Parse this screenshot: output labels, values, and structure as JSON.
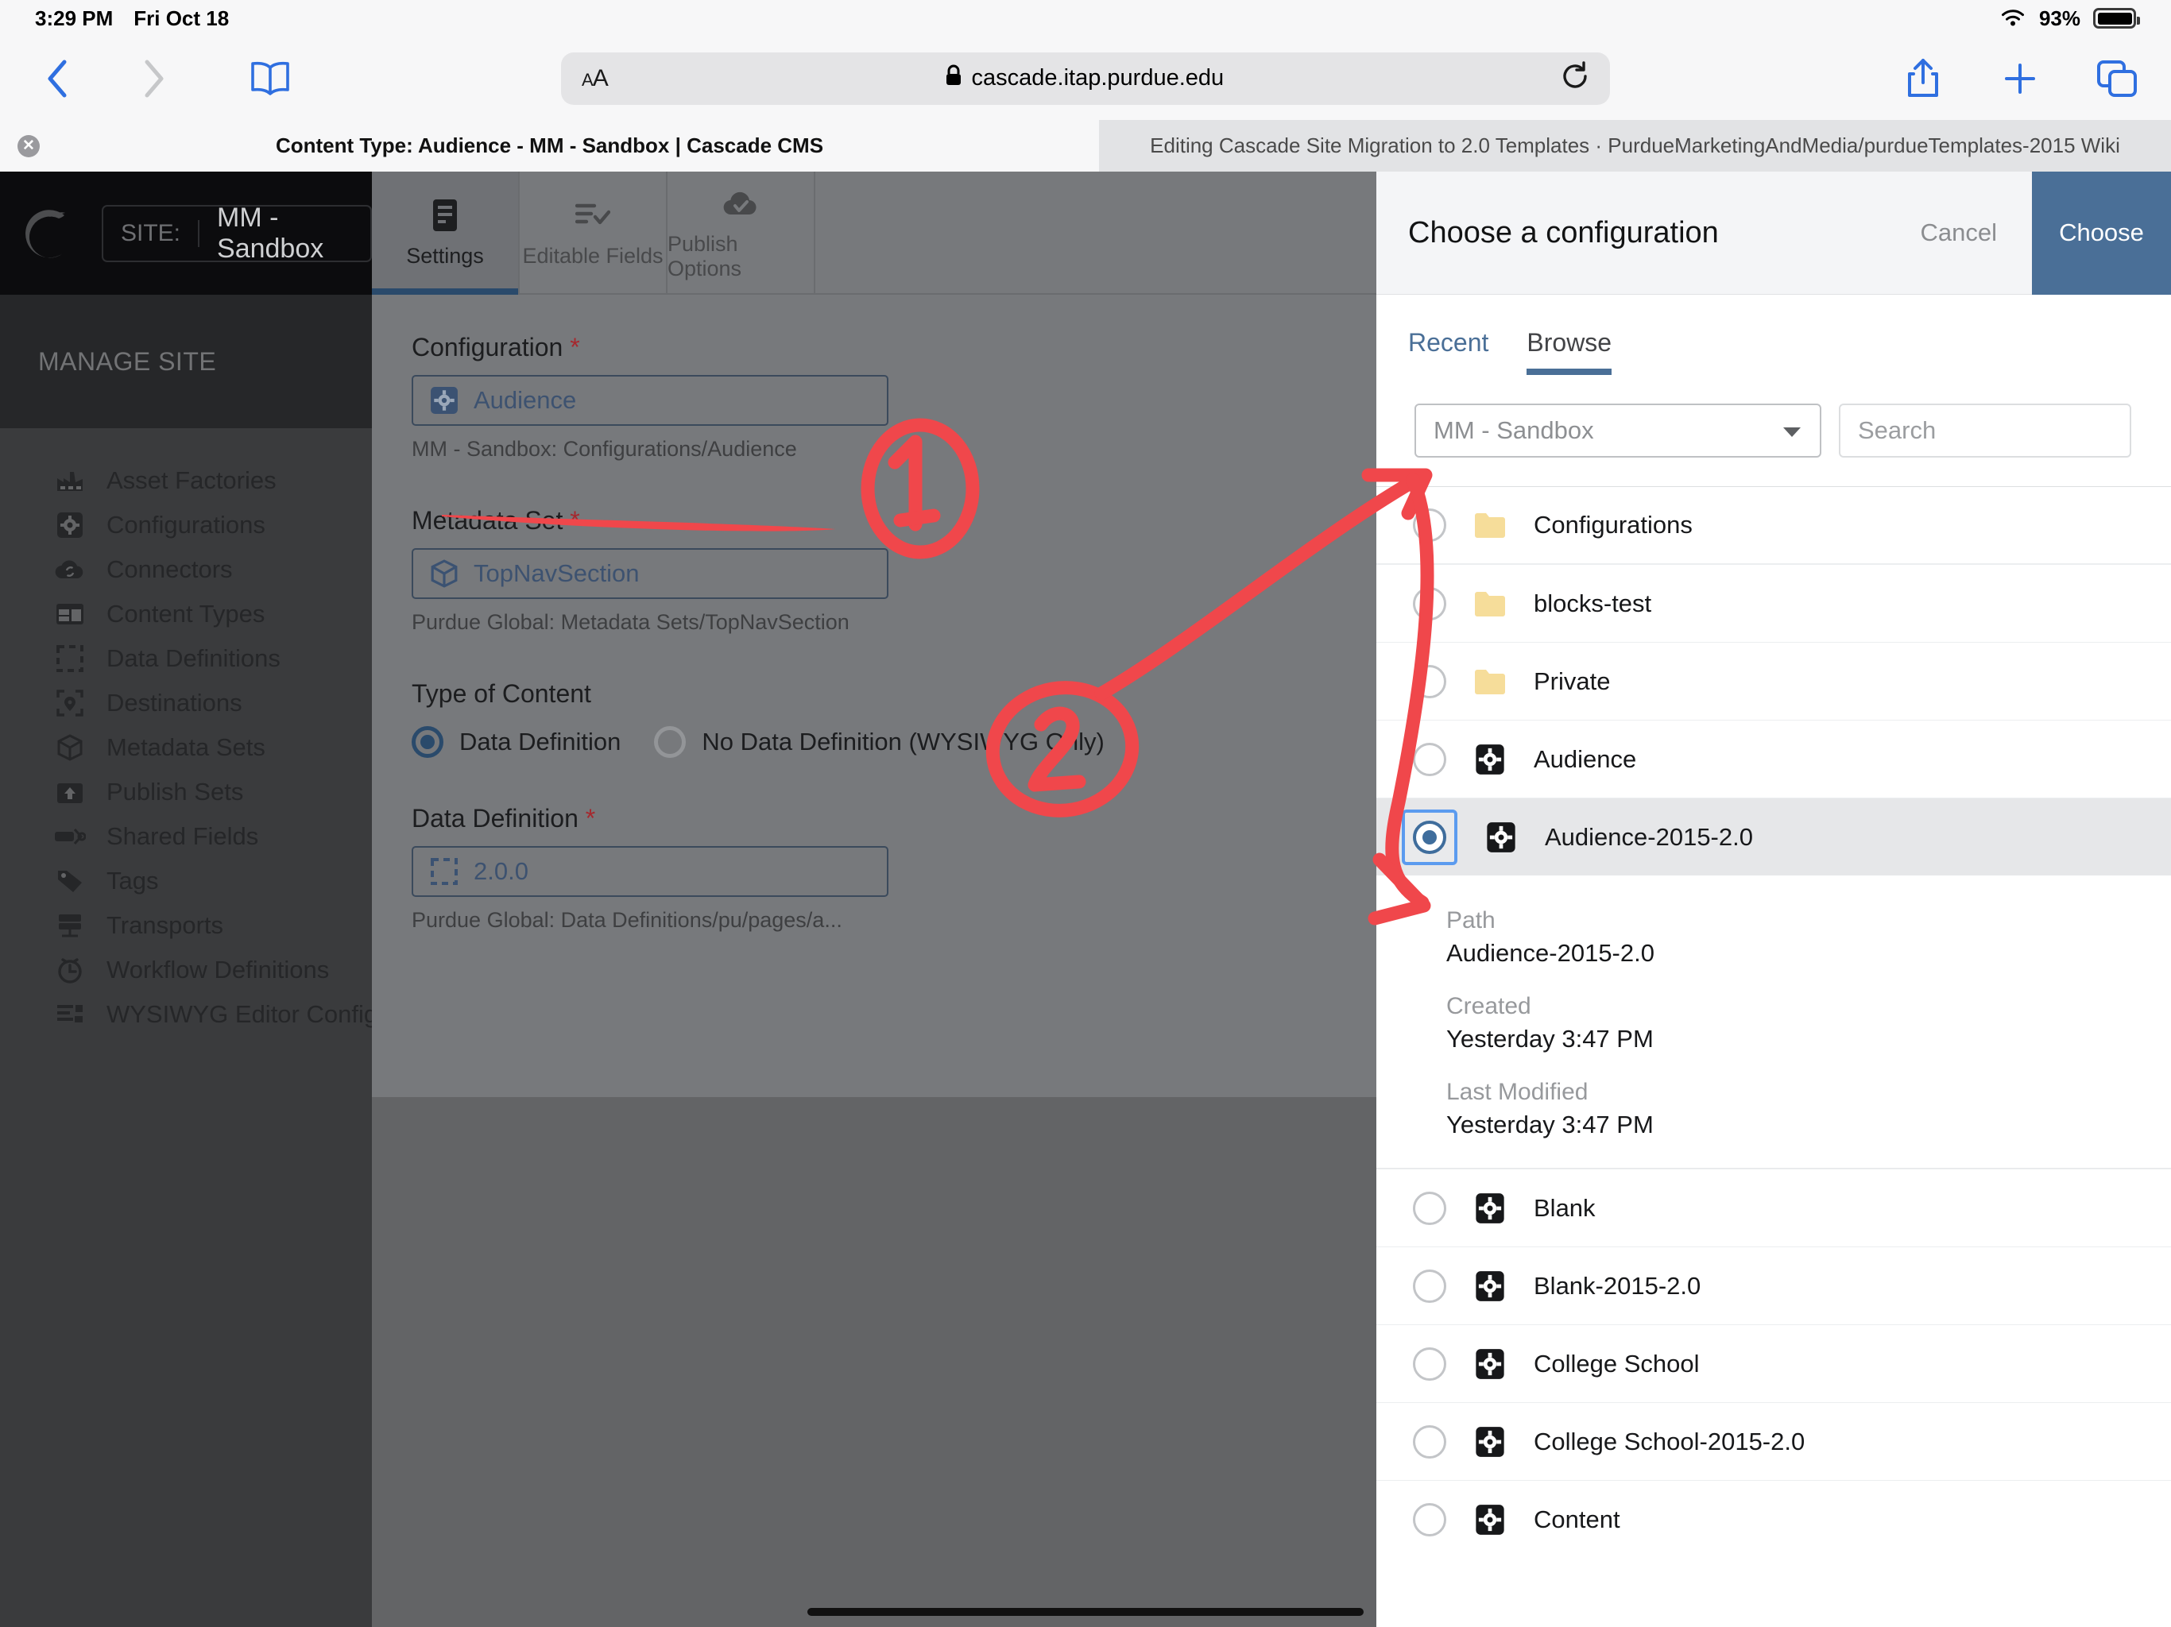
{
  "status_bar": {
    "time": "3:29 PM",
    "date": "Fri Oct 18",
    "battery_percent": "93%",
    "wifi_icon": "wifi-icon",
    "battery_icon": "battery-icon"
  },
  "browser": {
    "back_icon": "back-chevron-icon",
    "forward_icon": "forward-chevron-icon",
    "bookmarks_icon": "book-icon",
    "page_settings_label": "AA",
    "lock_icon": "lock-icon",
    "url": "cascade.itap.purdue.edu",
    "reload_icon": "reload-icon",
    "share_icon": "share-icon",
    "new_tab_icon": "plus-icon",
    "tabs_icon": "tab-overview-icon",
    "tabs": [
      {
        "title": "Content Type: Audience - MM - Sandbox | Cascade CMS",
        "active": true,
        "close_label": "✕"
      },
      {
        "title": "Editing Cascade Site Migration to 2.0 Templates · PurdueMarketingAndMedia/purdueTemplates-2015 Wiki",
        "active": false
      }
    ]
  },
  "cms": {
    "logo_icon": "cascade-moon-logo-icon",
    "site_label": "SITE:",
    "site_name": "MM - Sandbox",
    "section_header": "MANAGE SITE",
    "nav_items": [
      {
        "label": "Asset Factories",
        "icon": "factory-icon"
      },
      {
        "label": "Configurations",
        "icon": "gear-square-icon"
      },
      {
        "label": "Connectors",
        "icon": "cloud-sync-icon"
      },
      {
        "label": "Content Types",
        "icon": "layout-blocks-icon"
      },
      {
        "label": "Data Definitions",
        "icon": "dashed-square-icon"
      },
      {
        "label": "Destinations",
        "icon": "location-pin-icon"
      },
      {
        "label": "Metadata Sets",
        "icon": "cube-icon"
      },
      {
        "label": "Publish Sets",
        "icon": "upload-box-icon"
      },
      {
        "label": "Shared Fields",
        "icon": "shared-fields-icon"
      },
      {
        "label": "Tags",
        "icon": "tag-icon"
      },
      {
        "label": "Transports",
        "icon": "server-icon"
      },
      {
        "label": "Workflow Definitions",
        "icon": "clock-icon"
      },
      {
        "label": "WYSIWYG Editor Configura",
        "icon": "wysiwyg-icon"
      }
    ],
    "content_tabs": [
      {
        "label": "Settings",
        "icon": "document-lines-icon",
        "active": true
      },
      {
        "label": "Editable Fields",
        "icon": "list-check-icon",
        "active": false
      },
      {
        "label": "Publish Options",
        "icon": "cloud-check-icon",
        "active": false
      }
    ],
    "form": {
      "configuration": {
        "label": "Configuration",
        "required_mark": "*",
        "value": "Audience",
        "icon": "gear-square-icon",
        "hint": "MM - Sandbox: Configurations/Audience"
      },
      "metadata_set": {
        "label": "Metadata Set",
        "required_mark": "*",
        "value": "TopNavSection",
        "icon": "cube-icon",
        "hint": "Purdue Global: Metadata Sets/TopNavSection"
      },
      "type_of_content": {
        "label": "Type of Content",
        "options": [
          {
            "label": "Data Definition",
            "selected": true
          },
          {
            "label": "No Data Definition (WYSIWYG Only)",
            "selected": false
          }
        ]
      },
      "data_definition": {
        "label": "Data Definition",
        "required_mark": "*",
        "value": "2.0.0",
        "icon": "dashed-square-icon",
        "hint": "Purdue Global: Data Definitions/pu/pages/a..."
      }
    }
  },
  "modal": {
    "title": "Choose a configuration",
    "cancel_label": "Cancel",
    "choose_label": "Choose",
    "accent_color": "#4a6f97",
    "tabs": [
      {
        "label": "Recent",
        "active": false
      },
      {
        "label": "Browse",
        "active": true
      }
    ],
    "site_select": {
      "value": "MM - Sandbox",
      "caret_icon": "chevron-down-icon"
    },
    "search": {
      "placeholder": "Search",
      "value": ""
    },
    "items": [
      {
        "label": "Configurations",
        "icon": "folder-icon",
        "selected": false
      },
      {
        "label": "blocks-test",
        "icon": "folder-icon",
        "selected": false
      },
      {
        "label": "Private",
        "icon": "folder-icon",
        "selected": false
      },
      {
        "label": "Audience",
        "icon": "config-gear-icon",
        "selected": false
      },
      {
        "label": "Audience-2015-2.0",
        "icon": "config-gear-icon",
        "selected": true
      }
    ],
    "details": {
      "path_label": "Path",
      "path_value": "Audience-2015-2.0",
      "created_label": "Created",
      "created_value": "Yesterday 3:47 PM",
      "modified_label": "Last Modified",
      "modified_value": "Yesterday 3:47 PM"
    },
    "items_after": [
      {
        "label": "Blank",
        "icon": "config-gear-icon",
        "selected": false
      },
      {
        "label": "Blank-2015-2.0",
        "icon": "config-gear-icon",
        "selected": false
      },
      {
        "label": "College School",
        "icon": "config-gear-icon",
        "selected": false
      },
      {
        "label": "College School-2015-2.0",
        "icon": "config-gear-icon",
        "selected": false
      },
      {
        "label": "Content",
        "icon": "config-gear-icon",
        "selected": false
      }
    ]
  },
  "annotations": {
    "color": "#f0474b",
    "marker_1": "1",
    "marker_2": "2"
  }
}
